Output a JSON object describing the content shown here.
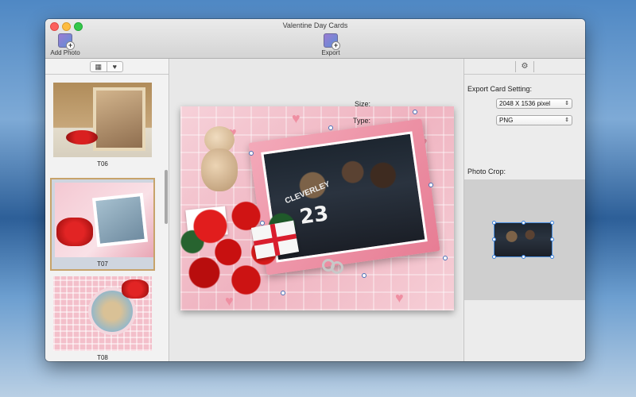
{
  "window": {
    "title": "Valentine Day Cards"
  },
  "toolbar": {
    "add_photo_label": "Add Photo",
    "export_label": "Export"
  },
  "left_panel": {
    "segments": [
      {
        "icon": "grid-icon",
        "glyph": "▦"
      },
      {
        "icon": "heart-icon",
        "glyph": "♥"
      }
    ],
    "templates": [
      {
        "label": "T06",
        "selected": false
      },
      {
        "label": "T07",
        "selected": true
      },
      {
        "label": "T08",
        "selected": false
      }
    ]
  },
  "card": {
    "jersey_name": "CLEVERLEY",
    "jersey_number": "23"
  },
  "right_panel": {
    "gear_glyph": "⚙",
    "export_heading": "Export Card Setting:",
    "size_label": "Size:",
    "size_value": "2048 X 1536 pixel",
    "type_label": "Type:",
    "type_value": "PNG",
    "photo_crop_label": "Photo Crop:"
  },
  "colors": {
    "accent": "#4a8fe0",
    "selection_border": "#c7a36a"
  }
}
